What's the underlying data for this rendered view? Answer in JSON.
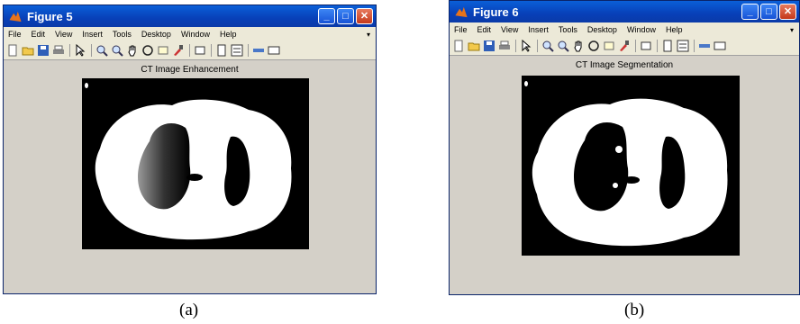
{
  "figure_a": {
    "window_title": "Figure 5",
    "menu": [
      "File",
      "Edit",
      "View",
      "Insert",
      "Tools",
      "Desktop",
      "Window",
      "Help"
    ],
    "axes_title": "CT Image Enhancement",
    "caption": "(a)"
  },
  "figure_b": {
    "window_title": "Figure 6",
    "menu": [
      "File",
      "Edit",
      "View",
      "Insert",
      "Tools",
      "Desktop",
      "Window",
      "Help"
    ],
    "axes_title": "CT Image Segmentation",
    "caption": "(b)"
  },
  "icons": {
    "toolbar": [
      "new-figure-icon",
      "open-icon",
      "save-icon",
      "print-icon",
      "pointer-icon",
      "zoom-in-icon",
      "zoom-out-icon",
      "pan-icon",
      "rotate-3d-icon",
      "data-cursor-icon",
      "brush-icon",
      "link-icon",
      "colorbar-icon",
      "legend-icon",
      "hide-plot-tools-icon",
      "show-plot-tools-icon"
    ]
  },
  "colors": {
    "title_bar": "#0a4fd0",
    "window_bg": "#d4d0c8",
    "close_button": "#c4391b"
  }
}
